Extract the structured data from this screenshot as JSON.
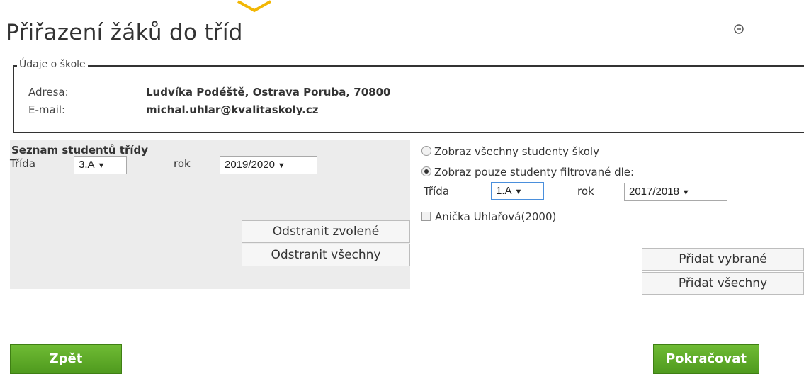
{
  "page": {
    "title": "Přiřazení žáků do tříd",
    "accent_color": "#f2b705",
    "collapse_icon": "minus-circle-icon"
  },
  "school": {
    "legend": "Údaje o škole",
    "address_label": "Adresa:",
    "address_value": "Ludvíka Podéště, Ostrava Poruba, 70800",
    "email_label": "E-mail:",
    "email_value": "michal.uhlar@kvalitaskoly.cz"
  },
  "class_list": {
    "title": "Seznam studentů třídy",
    "class_label": "Třída",
    "class_value": "3.A",
    "year_label": "rok",
    "year_value": "2019/2020",
    "remove_selected": "Odstranit zvolené",
    "remove_all": "Odstranit všechny"
  },
  "filter": {
    "option_all": "Zobraz všechny studenty školy",
    "option_filtered": "Zobraz pouze studenty filtrované dle:",
    "selected_option": "filtered",
    "class_label": "Třída",
    "class_value": "1.A",
    "year_label": "rok",
    "year_value": "2017/2018",
    "students": [
      "Anička Uhlařová(2000)"
    ],
    "add_selected": "Přidat vybrané",
    "add_all": "Přidat všechny"
  },
  "nav": {
    "back": "Zpět",
    "next": "Pokračovat",
    "button_color": "#5aa526"
  }
}
